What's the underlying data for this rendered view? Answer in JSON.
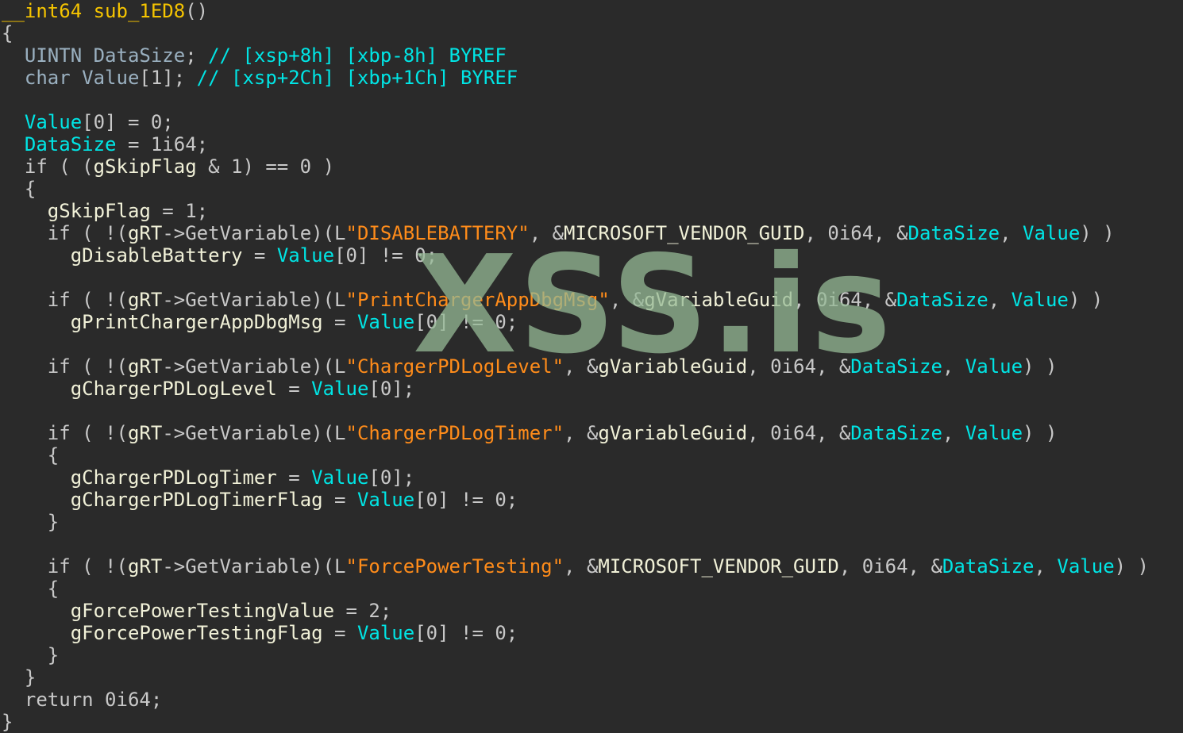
{
  "colors": {
    "background": "#2a2a2a",
    "keyword": "#c8c8c8",
    "signature": "#f5c400",
    "variable": "#00e5e5",
    "global": "#f1f1d8",
    "string": "#ff8c1a",
    "comment": "#00e5e5",
    "watermark": "#96b996"
  },
  "watermark": "XSS.is",
  "code": {
    "lines": [
      [
        {
          "t": "__int64 sub_1ED8",
          "c": "sig"
        },
        {
          "t": "()",
          "c": "plain"
        }
      ],
      [
        {
          "t": "{",
          "c": "plain"
        }
      ],
      [
        {
          "t": "  UINTN DataSize",
          "c": "local"
        },
        {
          "t": "; ",
          "c": "plain"
        },
        {
          "t": "// [xsp+8h] [xbp-8h] BYREF",
          "c": "com"
        }
      ],
      [
        {
          "t": "  char Value",
          "c": "local"
        },
        {
          "t": "[1]; ",
          "c": "plain"
        },
        {
          "t": "// [xsp+2Ch] [xbp+1Ch] BYREF",
          "c": "com"
        }
      ],
      [
        {
          "t": "",
          "c": "plain"
        }
      ],
      [
        {
          "t": "  ",
          "c": "plain"
        },
        {
          "t": "Value",
          "c": "var"
        },
        {
          "t": "[0] = 0;",
          "c": "plain"
        }
      ],
      [
        {
          "t": "  ",
          "c": "plain"
        },
        {
          "t": "DataSize",
          "c": "var"
        },
        {
          "t": " = 1i64;",
          "c": "plain"
        }
      ],
      [
        {
          "t": "  if ( (",
          "c": "plain"
        },
        {
          "t": "gSkipFlag",
          "c": "glob"
        },
        {
          "t": " & 1) == 0 )",
          "c": "plain"
        }
      ],
      [
        {
          "t": "  {",
          "c": "plain"
        }
      ],
      [
        {
          "t": "    ",
          "c": "plain"
        },
        {
          "t": "gSkipFlag",
          "c": "glob"
        },
        {
          "t": " = 1;",
          "c": "plain"
        }
      ],
      [
        {
          "t": "    if ( !(",
          "c": "plain"
        },
        {
          "t": "gRT",
          "c": "glob"
        },
        {
          "t": "->GetVariable)(L",
          "c": "plain"
        },
        {
          "t": "\"DISABLEBATTERY\"",
          "c": "str"
        },
        {
          "t": ", &",
          "c": "plain"
        },
        {
          "t": "MICROSOFT_VENDOR_GUID",
          "c": "glob"
        },
        {
          "t": ", 0i64, &",
          "c": "plain"
        },
        {
          "t": "DataSize",
          "c": "var"
        },
        {
          "t": ", ",
          "c": "plain"
        },
        {
          "t": "Value",
          "c": "var"
        },
        {
          "t": ") )",
          "c": "plain"
        }
      ],
      [
        {
          "t": "      ",
          "c": "plain"
        },
        {
          "t": "gDisableBattery",
          "c": "glob"
        },
        {
          "t": " = ",
          "c": "plain"
        },
        {
          "t": "Value",
          "c": "var"
        },
        {
          "t": "[0] != 0;",
          "c": "plain"
        }
      ],
      [
        {
          "t": "",
          "c": "plain"
        }
      ],
      [
        {
          "t": "    if ( !(",
          "c": "plain"
        },
        {
          "t": "gRT",
          "c": "glob"
        },
        {
          "t": "->GetVariable)(L",
          "c": "plain"
        },
        {
          "t": "\"PrintChargerAppDbgMsg\"",
          "c": "str"
        },
        {
          "t": ", &",
          "c": "plain"
        },
        {
          "t": "gVariableGuid",
          "c": "glob"
        },
        {
          "t": ", 0i64, &",
          "c": "plain"
        },
        {
          "t": "DataSize",
          "c": "var"
        },
        {
          "t": ", ",
          "c": "plain"
        },
        {
          "t": "Value",
          "c": "var"
        },
        {
          "t": ") )",
          "c": "plain"
        }
      ],
      [
        {
          "t": "      ",
          "c": "plain"
        },
        {
          "t": "gPrintChargerAppDbgMsg",
          "c": "glob"
        },
        {
          "t": " = ",
          "c": "plain"
        },
        {
          "t": "Value",
          "c": "var"
        },
        {
          "t": "[0] != 0;",
          "c": "plain"
        }
      ],
      [
        {
          "t": "",
          "c": "plain"
        }
      ],
      [
        {
          "t": "    if ( !(",
          "c": "plain"
        },
        {
          "t": "gRT",
          "c": "glob"
        },
        {
          "t": "->GetVariable)(L",
          "c": "plain"
        },
        {
          "t": "\"ChargerPDLogLevel\"",
          "c": "str"
        },
        {
          "t": ", &",
          "c": "plain"
        },
        {
          "t": "gVariableGuid",
          "c": "glob"
        },
        {
          "t": ", 0i64, &",
          "c": "plain"
        },
        {
          "t": "DataSize",
          "c": "var"
        },
        {
          "t": ", ",
          "c": "plain"
        },
        {
          "t": "Value",
          "c": "var"
        },
        {
          "t": ") )",
          "c": "plain"
        }
      ],
      [
        {
          "t": "      ",
          "c": "plain"
        },
        {
          "t": "gChargerPDLogLevel",
          "c": "glob"
        },
        {
          "t": " = ",
          "c": "plain"
        },
        {
          "t": "Value",
          "c": "var"
        },
        {
          "t": "[0];",
          "c": "plain"
        }
      ],
      [
        {
          "t": "",
          "c": "plain"
        }
      ],
      [
        {
          "t": "    if ( !(",
          "c": "plain"
        },
        {
          "t": "gRT",
          "c": "glob"
        },
        {
          "t": "->GetVariable)(L",
          "c": "plain"
        },
        {
          "t": "\"ChargerPDLogTimer\"",
          "c": "str"
        },
        {
          "t": ", &",
          "c": "plain"
        },
        {
          "t": "gVariableGuid",
          "c": "glob"
        },
        {
          "t": ", 0i64, &",
          "c": "plain"
        },
        {
          "t": "DataSize",
          "c": "var"
        },
        {
          "t": ", ",
          "c": "plain"
        },
        {
          "t": "Value",
          "c": "var"
        },
        {
          "t": ") )",
          "c": "plain"
        }
      ],
      [
        {
          "t": "    {",
          "c": "plain"
        }
      ],
      [
        {
          "t": "      ",
          "c": "plain"
        },
        {
          "t": "gChargerPDLogTimer",
          "c": "glob"
        },
        {
          "t": " = ",
          "c": "plain"
        },
        {
          "t": "Value",
          "c": "var"
        },
        {
          "t": "[0];",
          "c": "plain"
        }
      ],
      [
        {
          "t": "      ",
          "c": "plain"
        },
        {
          "t": "gChargerPDLogTimerFlag",
          "c": "glob"
        },
        {
          "t": " = ",
          "c": "plain"
        },
        {
          "t": "Value",
          "c": "var"
        },
        {
          "t": "[0] != 0;",
          "c": "plain"
        }
      ],
      [
        {
          "t": "    }",
          "c": "plain"
        }
      ],
      [
        {
          "t": "",
          "c": "plain"
        }
      ],
      [
        {
          "t": "    if ( !(",
          "c": "plain"
        },
        {
          "t": "gRT",
          "c": "glob"
        },
        {
          "t": "->GetVariable)(L",
          "c": "plain"
        },
        {
          "t": "\"ForcePowerTesting\"",
          "c": "str"
        },
        {
          "t": ", &",
          "c": "plain"
        },
        {
          "t": "MICROSOFT_VENDOR_GUID",
          "c": "glob"
        },
        {
          "t": ", 0i64, &",
          "c": "plain"
        },
        {
          "t": "DataSize",
          "c": "var"
        },
        {
          "t": ", ",
          "c": "plain"
        },
        {
          "t": "Value",
          "c": "var"
        },
        {
          "t": ") )",
          "c": "plain"
        }
      ],
      [
        {
          "t": "    {",
          "c": "plain"
        }
      ],
      [
        {
          "t": "      ",
          "c": "plain"
        },
        {
          "t": "gForcePowerTestingValue",
          "c": "glob"
        },
        {
          "t": " = 2;",
          "c": "plain"
        }
      ],
      [
        {
          "t": "      ",
          "c": "plain"
        },
        {
          "t": "gForcePowerTestingFlag",
          "c": "glob"
        },
        {
          "t": " = ",
          "c": "plain"
        },
        {
          "t": "Value",
          "c": "var"
        },
        {
          "t": "[0] != 0;",
          "c": "plain"
        }
      ],
      [
        {
          "t": "    }",
          "c": "plain"
        }
      ],
      [
        {
          "t": "  }",
          "c": "plain"
        }
      ],
      [
        {
          "t": "  return 0i64;",
          "c": "plain"
        }
      ],
      [
        {
          "t": "}",
          "c": "plain"
        }
      ]
    ]
  }
}
